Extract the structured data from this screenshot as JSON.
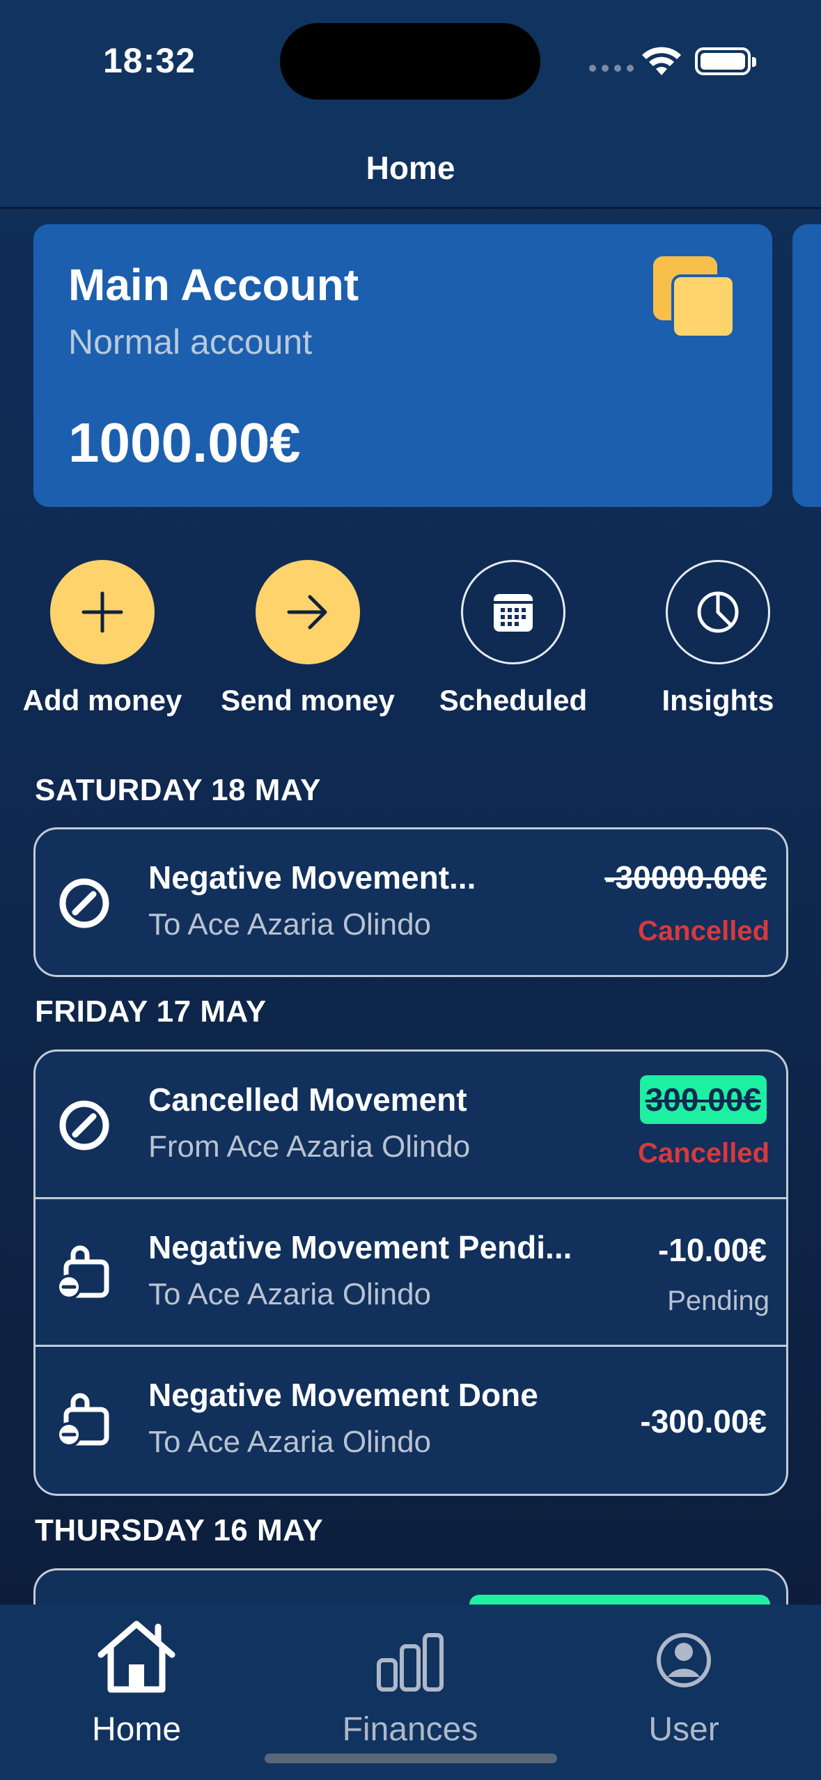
{
  "status_bar": {
    "time": "18:32"
  },
  "header": {
    "title": "Home"
  },
  "account": {
    "name": "Main Account",
    "type": "Normal account",
    "balance": "1000.00€"
  },
  "actions": [
    {
      "label": "Add money",
      "icon": "plus-icon"
    },
    {
      "label": "Send money",
      "icon": "arrow-right-icon"
    },
    {
      "label": "Scheduled",
      "icon": "calendar-icon"
    },
    {
      "label": "Insights",
      "icon": "pie-chart-icon"
    }
  ],
  "days": [
    {
      "label": "SATURDAY 18 MAY",
      "movements": [
        {
          "title": "Negative Movement...",
          "subtitle": "To Ace Azaria Olindo",
          "amount": "-30000.00€",
          "status": "Cancelled",
          "icon": "cancel-icon"
        }
      ]
    },
    {
      "label": "FRIDAY 17 MAY",
      "movements": [
        {
          "title": "Cancelled Movement",
          "subtitle": "From Ace Azaria Olindo",
          "amount": "300.00€",
          "status": "Cancelled",
          "icon": "cancel-icon"
        },
        {
          "title": "Negative Movement Pendi...",
          "subtitle": "To Ace Azaria Olindo",
          "amount": "-10.00€",
          "status": "Pending",
          "icon": "bag-minus-icon"
        },
        {
          "title": "Negative Movement Done",
          "subtitle": "To Ace Azaria Olindo",
          "amount": "-300.00€",
          "status": "",
          "icon": "bag-minus-icon"
        }
      ]
    },
    {
      "label": "THURSDAY 16 MAY"
    }
  ],
  "tabbar": [
    {
      "label": "Home",
      "icon": "home-icon",
      "active": true
    },
    {
      "label": "Finances",
      "icon": "bar-chart-icon",
      "active": false
    },
    {
      "label": "User",
      "icon": "user-icon",
      "active": false
    }
  ],
  "colors": {
    "background": "#0f2a52",
    "card": "#1c5fae",
    "accent": "#ffd36b",
    "cancelled": "#d8393d",
    "income_chip": "#1ef0a2"
  }
}
